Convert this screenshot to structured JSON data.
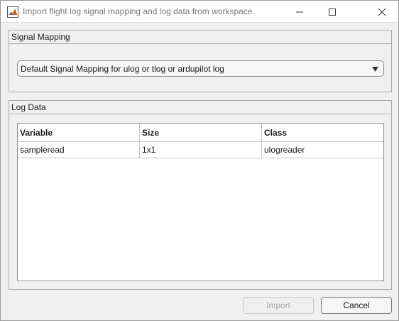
{
  "window": {
    "title": "Import flight log signal mapping and log data from workspace",
    "icon": "matlab-logo-icon",
    "controls": [
      "minimize-icon",
      "maximize-icon",
      "close-icon"
    ]
  },
  "signal_mapping": {
    "title": "Signal Mapping",
    "selected": "Default Signal Mapping for ulog or tlog or ardupilot log"
  },
  "log_data": {
    "title": "Log Data",
    "columns": [
      "Variable",
      "Size",
      "Class"
    ],
    "rows": [
      [
        "sampleread",
        "1x1",
        "ulogreader"
      ]
    ]
  },
  "buttons": {
    "import": "Import",
    "import_enabled": false,
    "cancel": "Cancel"
  },
  "colors": {
    "window_bg": "#f0f0f0",
    "disabled_text": "#a8a8a8",
    "border": "#a8a8a8"
  }
}
